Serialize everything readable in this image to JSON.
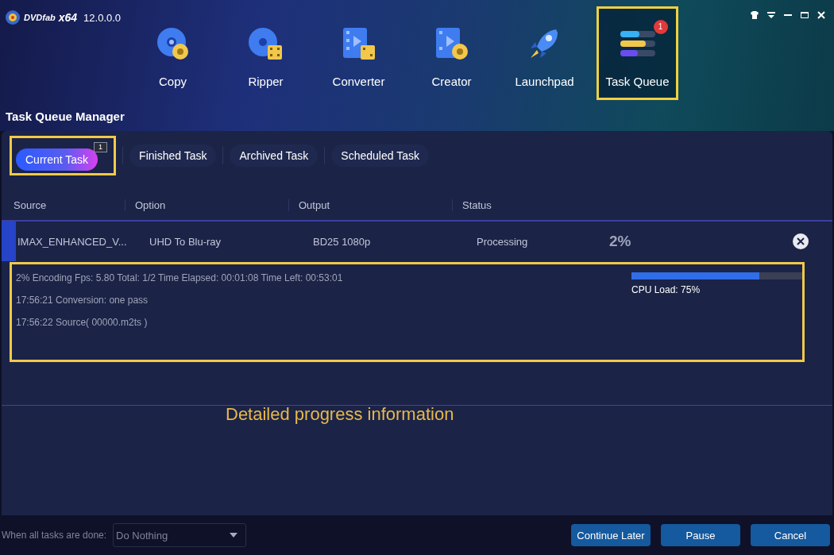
{
  "window": {
    "brand": "DVDfab",
    "edition": "x64",
    "version": "12.0.0.0"
  },
  "nav": [
    {
      "kind": "copy",
      "label": "Copy",
      "selected": false,
      "highlighted": false
    },
    {
      "kind": "ripper",
      "label": "Ripper",
      "selected": false,
      "highlighted": false
    },
    {
      "kind": "converter",
      "label": "Converter",
      "selected": false,
      "highlighted": false
    },
    {
      "kind": "creator",
      "label": "Creator",
      "selected": false,
      "highlighted": false
    },
    {
      "kind": "launchpad",
      "label": "Launchpad",
      "selected": false,
      "highlighted": false
    },
    {
      "kind": "queue",
      "label": "Task Queue",
      "selected": true,
      "highlighted": true,
      "badge": "1"
    }
  ],
  "section_title": "Task Queue Manager",
  "tabs": [
    {
      "label": "Current Task",
      "selected": true,
      "highlighted": true,
      "badge": "1"
    },
    {
      "label": "Finished Task",
      "selected": false,
      "highlighted": false
    },
    {
      "label": "Archived Task",
      "selected": false,
      "highlighted": false
    },
    {
      "label": "Scheduled Task",
      "selected": false,
      "highlighted": false
    }
  ],
  "table": {
    "columns": [
      "Source",
      "Option",
      "Output",
      "Status"
    ],
    "rows": [
      {
        "source": "IMAX_ENHANCED_V...",
        "option": "UHD To Blu-ray",
        "output": "BD25 1080p",
        "status": "Processing",
        "percent": "2%",
        "selected": true
      }
    ]
  },
  "details": {
    "highlighted": true,
    "lines": [
      "2%  Encoding Fps: 5.80   Total: 1/2  Time Elapsed: 00:01:08  Time Left: 00:53:01",
      "17:56:21  Conversion: one pass",
      "17:56:22  Source( 00000.m2ts )"
    ],
    "cpu": {
      "level": 0.75,
      "label": "CPU Load: 75%"
    }
  },
  "annotation": "Detailed progress information",
  "footer": {
    "label": "When all tasks are done:",
    "select": {
      "value": "Do Nothing"
    },
    "buttons": [
      "Continue Later",
      "Pause",
      "Cancel"
    ]
  }
}
